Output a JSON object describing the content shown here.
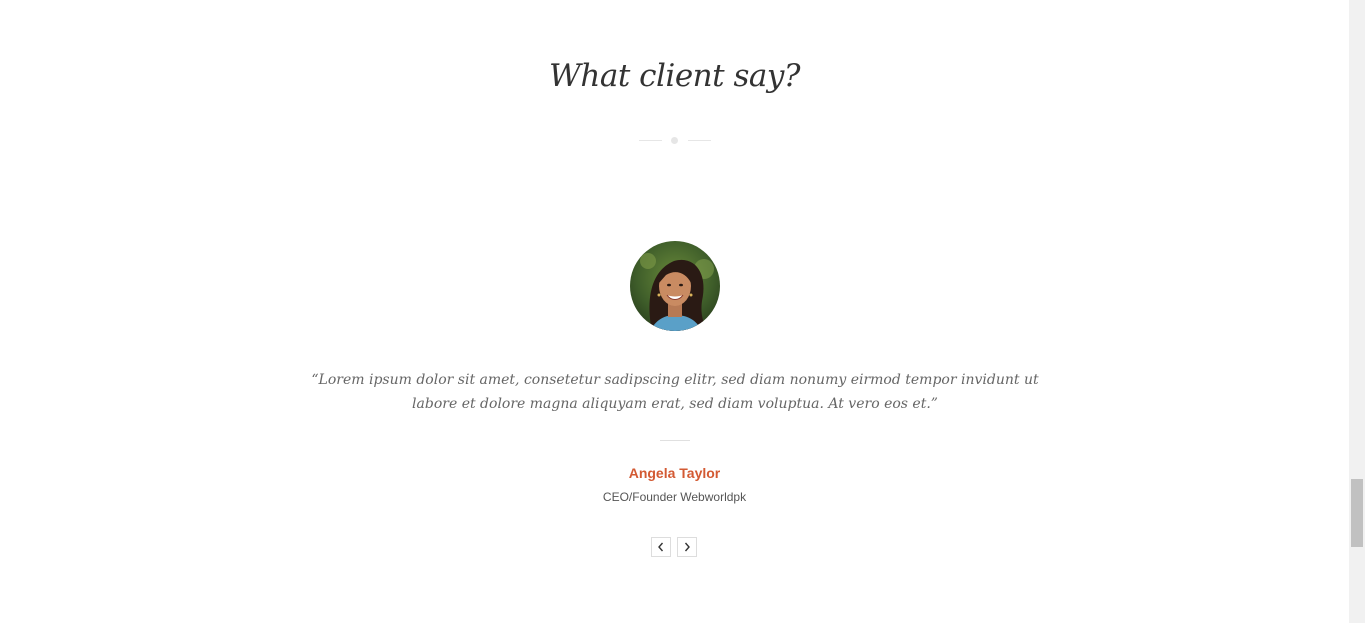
{
  "section": {
    "title": "What client say?"
  },
  "testimonial": {
    "quote": "“Lorem ipsum dolor sit amet, consetetur sadipscing elitr, sed diam nonumy eirmod tempor invidunt ut labore et dolore magna aliquyam erat, sed diam voluptua. At vero eos et.”",
    "author_name": "Angela Taylor",
    "author_role": "CEO/Founder Webworldpk"
  },
  "carousel": {
    "prev_icon": "chevron-left-icon",
    "next_icon": "chevron-right-icon"
  },
  "colors": {
    "accent": "#d35a33",
    "heading": "#333333",
    "body_text": "#666666"
  }
}
